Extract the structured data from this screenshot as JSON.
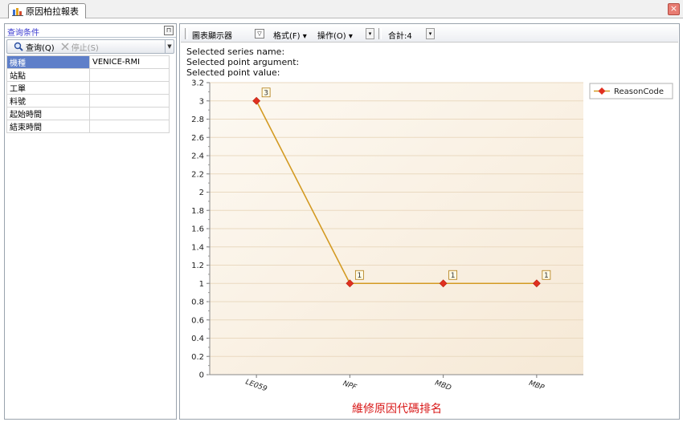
{
  "window": {
    "tab_title": "原因柏拉報表"
  },
  "query_panel": {
    "title": "查询条件",
    "query_label": "查询(Q)",
    "stop_label": "停止(S)",
    "fields": [
      {
        "label": "機種",
        "value": "VENICE-RMI",
        "selected": true
      },
      {
        "label": "站點",
        "value": ""
      },
      {
        "label": "工單",
        "value": ""
      },
      {
        "label": "料號",
        "value": ""
      },
      {
        "label": "起始時間",
        "value": ""
      },
      {
        "label": "結束時間",
        "value": ""
      }
    ]
  },
  "chart_toolbar": {
    "viewer_label": "圖表顯示器",
    "format_label": "格式(F)",
    "operate_label": "操作(O)",
    "total_label": "合計:4"
  },
  "info": {
    "series_name": "Selected series name:",
    "point_argument": "Selected point argument:",
    "point_value": "Selected point value:"
  },
  "colors": {
    "line": "#d39a22",
    "marker": "#e03020",
    "title": "#d81818",
    "accent": "#5e7fc9"
  },
  "chart_data": {
    "type": "line",
    "title": "維修原因代碼排名",
    "categories": [
      "LE059",
      "NPF",
      "MBD",
      "MBP"
    ],
    "series": [
      {
        "name": "ReasonCode",
        "values": [
          3,
          1,
          1,
          1
        ]
      }
    ],
    "data_labels": [
      "3",
      "1",
      "1",
      "1"
    ],
    "ylim": [
      0,
      3.2
    ],
    "yticks": [
      "0",
      "0.2",
      "0.4",
      "0.6",
      "0.8",
      "1",
      "1.2",
      "1.4",
      "1.6",
      "1.8",
      "2",
      "2.2",
      "2.4",
      "2.6",
      "2.8",
      "3",
      "3.2"
    ],
    "grid": true,
    "legend": "top-right"
  }
}
